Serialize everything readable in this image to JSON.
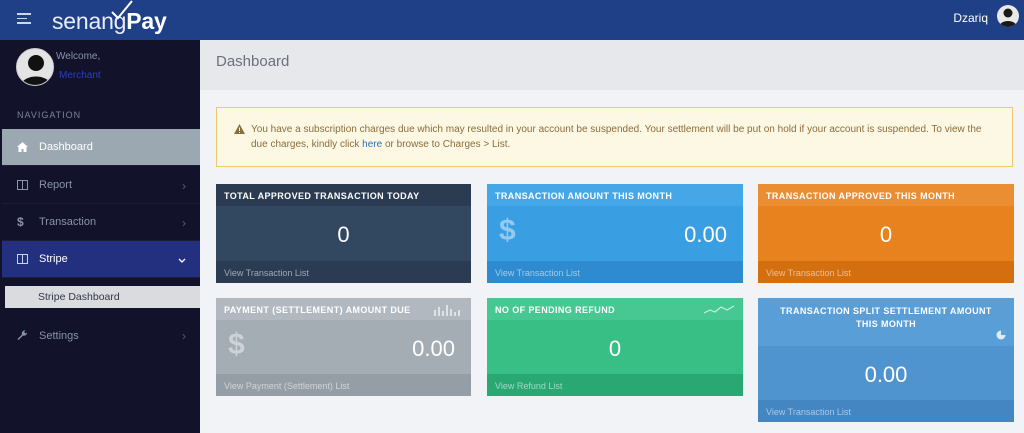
{
  "topbar": {
    "brand_light": "senang",
    "brand_bold": "Pay",
    "username": "Dzariq"
  },
  "sidebar": {
    "welcome": "Welcome,",
    "role": "Merchant",
    "nav_heading": "NAVIGATION",
    "items": [
      {
        "label": "Dashboard",
        "icon": "home-icon"
      },
      {
        "label": "Report",
        "icon": "book-icon"
      },
      {
        "label": "Transaction",
        "icon": "dollar-icon"
      },
      {
        "label": "Stripe",
        "icon": "book-icon"
      },
      {
        "label": "Settings",
        "icon": "wrench-icon"
      }
    ],
    "stripe_submenu": [
      "Stripe Dashboard"
    ]
  },
  "page": {
    "title": "Dashboard"
  },
  "alert": {
    "text_before": "You have a subscription charges due which may resulted in your account be suspended. Your settlement will be put on hold if your account is suspended. To view the due charges, kindly click ",
    "link": "here",
    "text_after": " or browse to Charges > List."
  },
  "cards": [
    {
      "title": "TOTAL APPROVED TRANSACTION TODAY",
      "value": "0",
      "footer": "View Transaction List",
      "color": "#324760"
    },
    {
      "title": "TRANSACTION AMOUNT THIS MONTH",
      "value": "0.00",
      "footer": "View Transaction List",
      "color": "#3a9ee3"
    },
    {
      "title": "TRANSACTION APPROVED THIS MONTH",
      "value": "0",
      "footer": "View Transaction List",
      "color": "#e8821e"
    },
    {
      "title": "PAYMENT (SETTLEMENT) AMOUNT DUE",
      "value": "0.00",
      "footer": "View Payment (Settlement) List",
      "color": "#a4adb4"
    },
    {
      "title": "NO OF PENDING REFUND",
      "value": "0",
      "footer": "View Refund List",
      "color": "#37bf86"
    },
    {
      "title": "TRANSACTION SPLIT SETTLEMENT AMOUNT THIS MONTH",
      "value": "0.00",
      "footer": "View Transaction List",
      "color": "#4f94cf"
    }
  ],
  "currency_symbol": "$",
  "colors": {
    "topbar": "#1f3f86",
    "sidebar": "#12122a",
    "active_nav": "#9ba8b2",
    "stripe_nav": "#22307f"
  }
}
